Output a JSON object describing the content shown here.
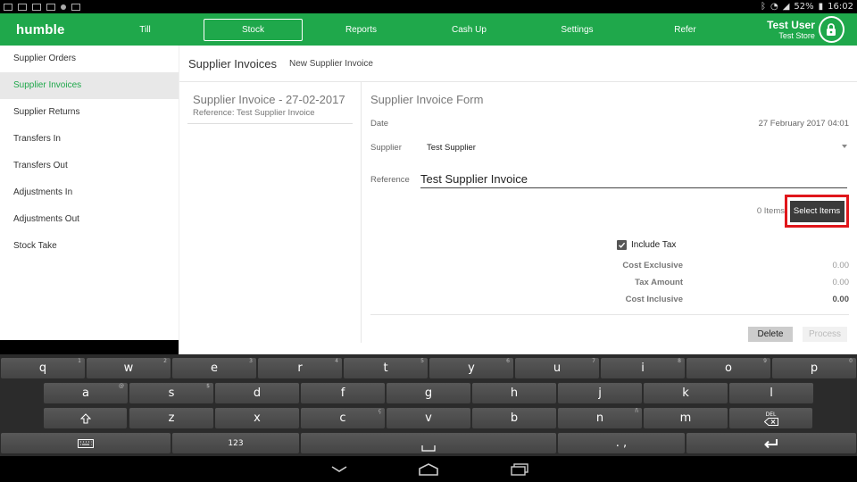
{
  "status_bar": {
    "battery": "52%",
    "time": "16:02"
  },
  "app": {
    "logo": "humble"
  },
  "nav": {
    "tabs": [
      {
        "label": "Till"
      },
      {
        "label": "Stock"
      },
      {
        "label": "Reports"
      },
      {
        "label": "Cash Up"
      },
      {
        "label": "Settings"
      },
      {
        "label": "Refer"
      }
    ],
    "active": "Stock"
  },
  "user": {
    "name": "Test User",
    "store": "Test Store"
  },
  "sidebar": {
    "items": [
      {
        "label": "Supplier Orders"
      },
      {
        "label": "Supplier Invoices"
      },
      {
        "label": "Supplier Returns"
      },
      {
        "label": "Transfers In"
      },
      {
        "label": "Transfers Out"
      },
      {
        "label": "Adjustments In"
      },
      {
        "label": "Adjustments Out"
      },
      {
        "label": "Stock Take"
      }
    ],
    "active": "Supplier Invoices"
  },
  "breadcrumb": {
    "title": "Supplier Invoices",
    "sub": "New Supplier Invoice"
  },
  "invoice_list": [
    {
      "title": "Supplier Invoice - 27-02-2017",
      "reference": "Reference: Test Supplier Invoice"
    }
  ],
  "form": {
    "title": "Supplier Invoice Form",
    "date_label": "Date",
    "date_value": "27 February 2017 04:01",
    "supplier_label": "Supplier",
    "supplier_value": "Test Supplier",
    "reference_label": "Reference",
    "reference_value": "Test Supplier Invoice",
    "items_count": "0 Items",
    "select_items_label": "Select Items",
    "include_tax_label": "Include Tax",
    "include_tax_checked": true,
    "summary": [
      {
        "label": "Cost Exclusive",
        "value": "0.00"
      },
      {
        "label": "Tax Amount",
        "value": "0.00"
      },
      {
        "label": "Cost Inclusive",
        "value": "0.00"
      }
    ],
    "delete_label": "Delete",
    "process_label": "Process"
  },
  "keyboard": {
    "row1": [
      {
        "k": "q",
        "h": "1"
      },
      {
        "k": "w",
        "h": "2"
      },
      {
        "k": "e",
        "h": "3"
      },
      {
        "k": "r",
        "h": "4"
      },
      {
        "k": "t",
        "h": "5"
      },
      {
        "k": "y",
        "h": "6"
      },
      {
        "k": "u",
        "h": "7"
      },
      {
        "k": "i",
        "h": "8"
      },
      {
        "k": "o",
        "h": "9"
      },
      {
        "k": "p",
        "h": "0"
      }
    ],
    "row2": [
      {
        "k": "a",
        "h": "@"
      },
      {
        "k": "s",
        "h": "$"
      },
      {
        "k": "d",
        "h": ""
      },
      {
        "k": "f",
        "h": ""
      },
      {
        "k": "g",
        "h": ""
      },
      {
        "k": "h",
        "h": ""
      },
      {
        "k": "j",
        "h": ""
      },
      {
        "k": "k",
        "h": ""
      },
      {
        "k": "l",
        "h": ""
      }
    ],
    "row3": [
      {
        "k": "z",
        "h": ""
      },
      {
        "k": "x",
        "h": ""
      },
      {
        "k": "c",
        "h": "ç"
      },
      {
        "k": "v",
        "h": ""
      },
      {
        "k": "b",
        "h": ""
      },
      {
        "k": "n",
        "h": "ñ"
      },
      {
        "k": "m",
        "h": ""
      }
    ],
    "del_label": "DEL",
    "numbers_label": "123",
    "punct_label": ". ,"
  },
  "colors": {
    "brand": "#1fa84b",
    "highlight": "#e0161b"
  }
}
